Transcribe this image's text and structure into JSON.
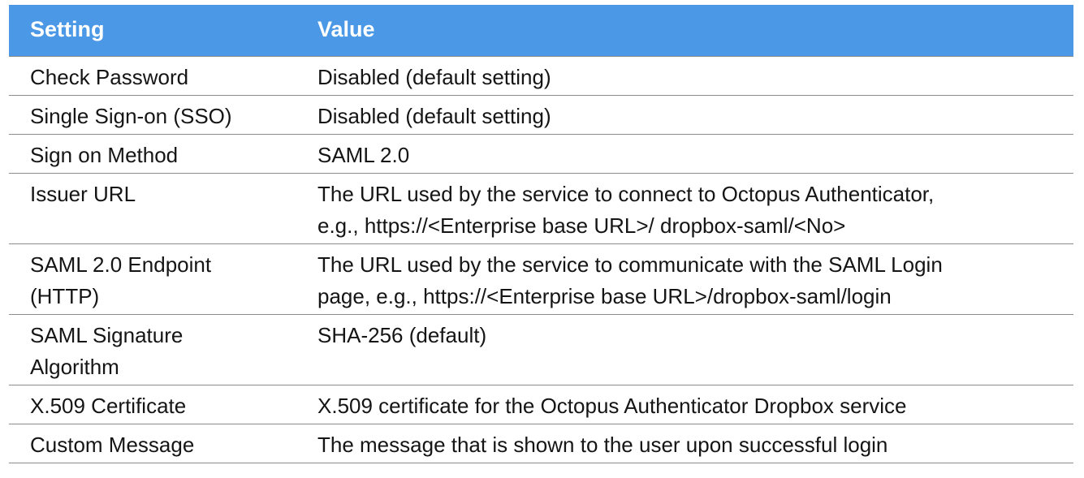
{
  "table": {
    "headers": {
      "setting": "Setting",
      "value": "Value"
    },
    "rows": [
      {
        "setting": "Check Password",
        "value": "Disabled (default setting)"
      },
      {
        "setting": "Single Sign-on (SSO)",
        "value": "Disabled (default setting)"
      },
      {
        "setting": "Sign on Method",
        "value": "SAML 2.0"
      },
      {
        "setting": "Issuer URL",
        "value": "The URL used by the service to connect to Octopus Authenticator,\ne.g., https://<Enterprise base URL>/ dropbox-saml/<No>"
      },
      {
        "setting": "SAML 2.0 Endpoint\n(HTTP)",
        "value": "The URL used by the service to communicate with the SAML Login\npage, e.g., https://<Enterprise base URL>/dropbox-saml/login"
      },
      {
        "setting": "SAML Signature\nAlgorithm",
        "value": "SHA-256 (default)"
      },
      {
        "setting": "X.509 Certificate",
        "value": "X.509 certificate for the Octopus Authenticator Dropbox service"
      },
      {
        "setting": "Custom Message",
        "value": "The message that is shown to the user upon successful login"
      }
    ],
    "colors": {
      "header_background": "#4a98e6",
      "header_text": "#ffffff",
      "row_divider": "#8c8c8c"
    }
  }
}
